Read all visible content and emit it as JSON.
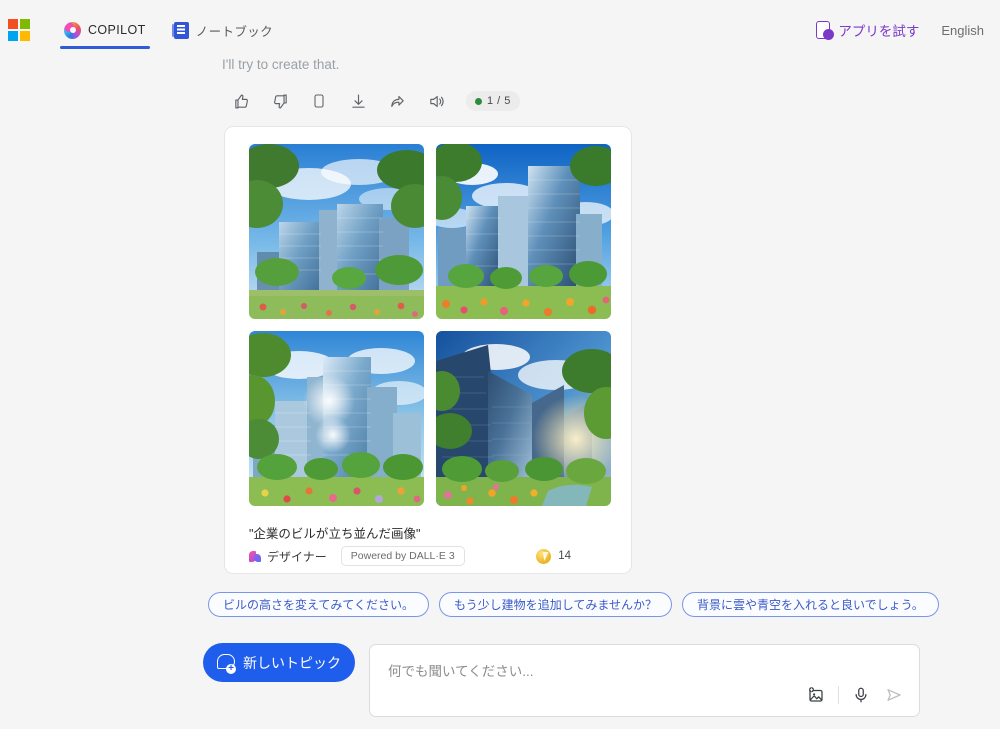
{
  "header": {
    "logo_name": "microsoft-logo",
    "tabs": [
      {
        "label": "COPILOT",
        "icon": "copilot-swirl-icon",
        "active": true
      },
      {
        "label": "ノートブック",
        "icon": "notebook-icon",
        "active": false
      }
    ],
    "try_app_label": "アプリを試す",
    "try_app_icon": "phone-app-icon",
    "language_label": "English"
  },
  "conversation": {
    "assistant_message": "I'll try to create that.",
    "actions": [
      {
        "name": "thumbs-up-icon",
        "label": "Like"
      },
      {
        "name": "thumbs-down-icon",
        "label": "Dislike"
      },
      {
        "name": "copy-icon",
        "label": "Copy"
      },
      {
        "name": "download-icon",
        "label": "Download"
      },
      {
        "name": "share-icon",
        "label": "Share"
      },
      {
        "name": "speaker-icon",
        "label": "Read aloud"
      }
    ],
    "message_counter": "1 / 5"
  },
  "image_card": {
    "caption": "\"企業のビルが立ち並んだ画像\"",
    "designer_label": "デザイナー",
    "dalle_badge": "Powered by DALL·E 3",
    "credits": "14",
    "credits_icon": "coin-boost-icon",
    "images": [
      {
        "alt": "glass office buildings with blue sky and green trees"
      },
      {
        "alt": "tall glass towers with clouds and orange flowers"
      },
      {
        "alt": "sunlit skyscrapers with trees and flower beds"
      },
      {
        "alt": "upward view of blue glass towers in a garden"
      }
    ]
  },
  "suggestions": [
    "ビルの高さを変えてみてください。",
    "もう少し建物を追加してみませんか？",
    "背景に雲や青空を入れると良いでしょう。"
  ],
  "composer": {
    "new_topic_label": "新しいトピック",
    "new_topic_icon": "new-chat-bubble-icon",
    "input_value": "",
    "placeholder": "何でも聞いてください...",
    "tools": [
      {
        "name": "add-image-icon"
      },
      {
        "name": "microphone-icon"
      },
      {
        "name": "send-icon"
      }
    ]
  },
  "colors": {
    "accent_blue": "#1f5eec",
    "tab_underline": "#2f5bd6",
    "purple": "#7a39c9",
    "chip_border": "#7a96e8",
    "page_bg": "#f5f5f5"
  }
}
